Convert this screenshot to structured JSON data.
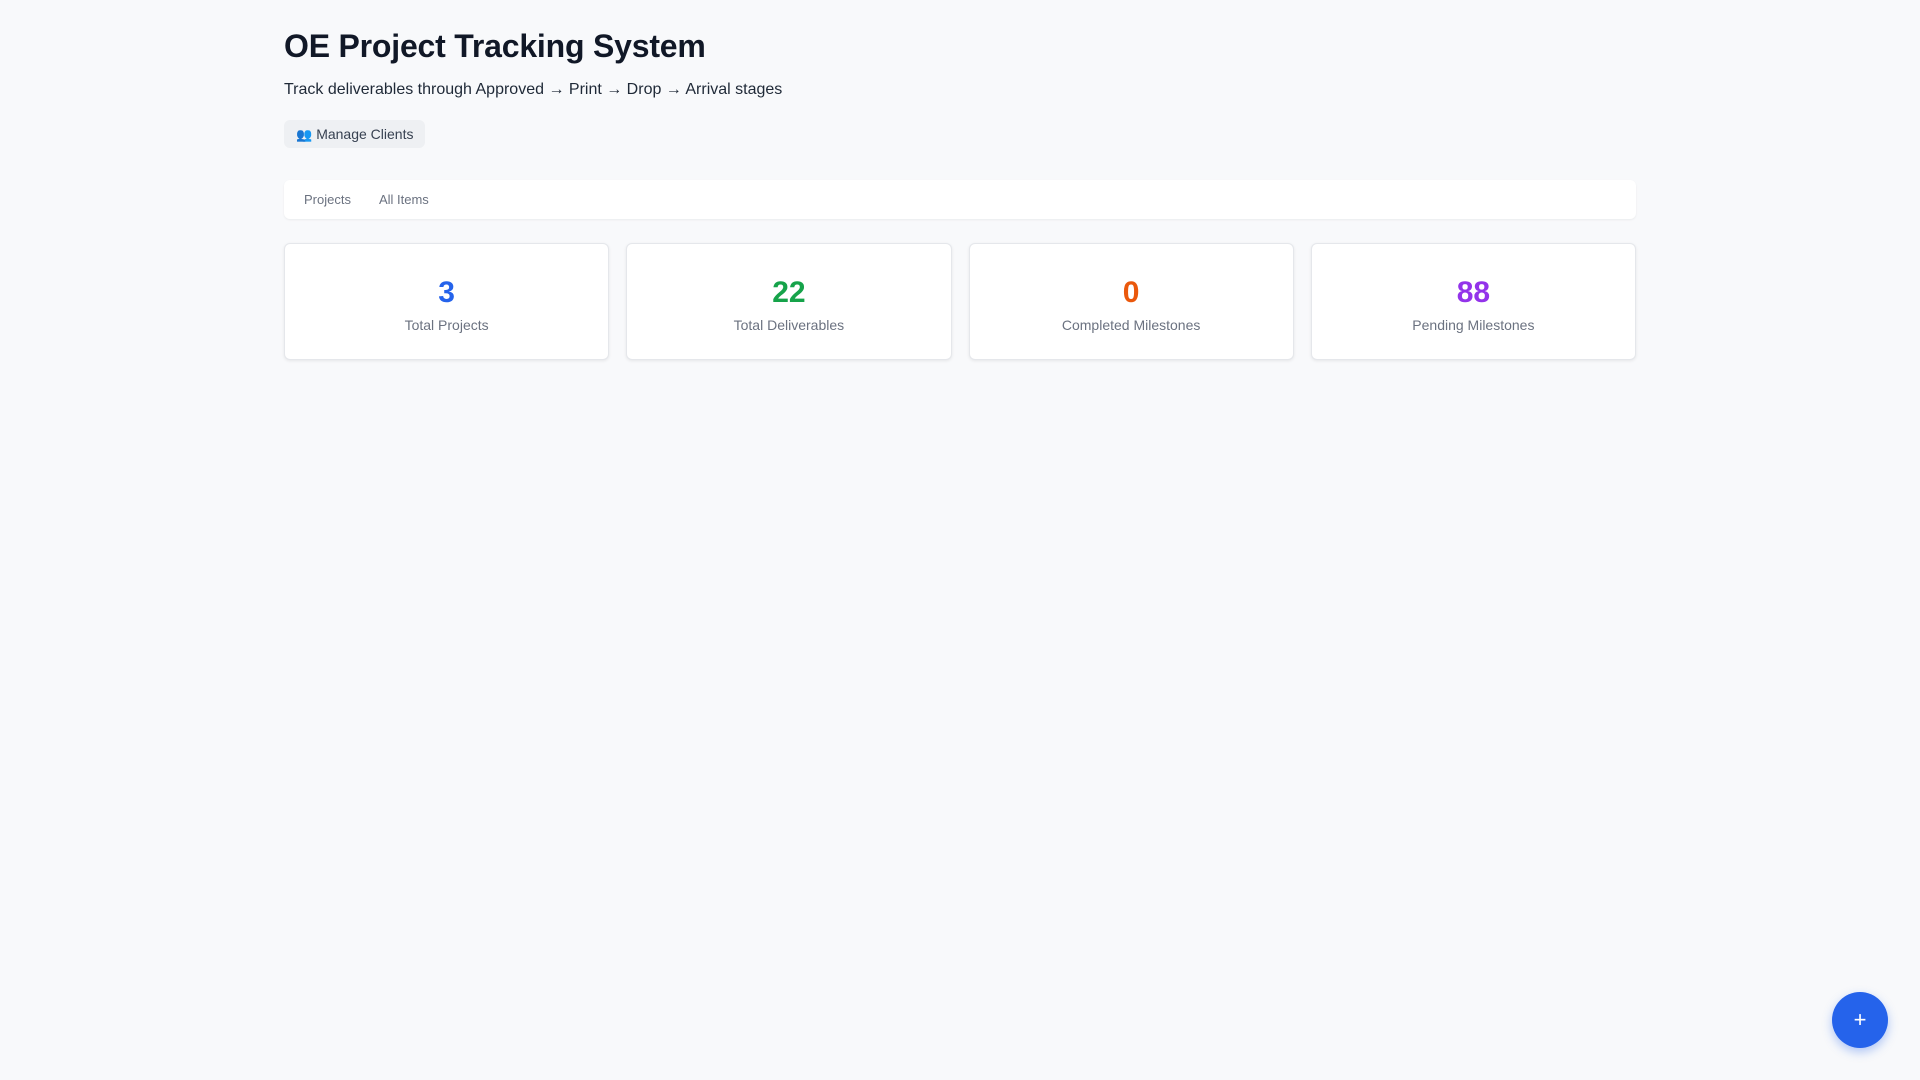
{
  "header": {
    "title": "OE Project Tracking System",
    "subtitle": "Track deliverables through Approved → Print → Drop → Arrival stages",
    "manage_clients": {
      "icon": "users-icon",
      "icon_glyph": "👥",
      "label": "Manage Clients"
    }
  },
  "tabs": [
    {
      "label": "Projects"
    },
    {
      "label": "All Items"
    }
  ],
  "stats": [
    {
      "value": "3",
      "label": "Total Projects",
      "color": "#2563eb"
    },
    {
      "value": "22",
      "label": "Total Deliverables",
      "color": "#16a34a"
    },
    {
      "value": "0",
      "label": "Completed Milestones",
      "color": "#ea580c"
    },
    {
      "value": "88",
      "label": "Pending Milestones",
      "color": "#9333ea"
    }
  ],
  "fab": {
    "icon": "plus-icon",
    "glyph": "+"
  }
}
